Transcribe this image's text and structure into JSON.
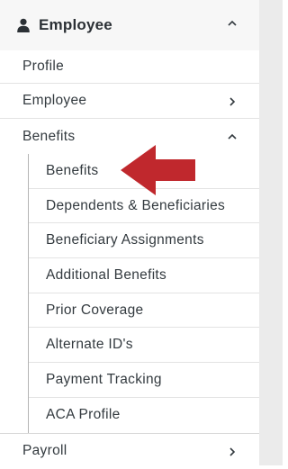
{
  "header": {
    "icon": "user-icon",
    "title": "Employee",
    "chevron": "chevron-up-icon"
  },
  "items": {
    "profile": "Profile",
    "employee": "Employee",
    "benefits": "Benefits",
    "payroll": "Payroll"
  },
  "benefits_sub": [
    "Benefits",
    "Dependents & Beneficiaries",
    "Beneficiary Assignments",
    "Additional Benefits",
    "Prior Coverage",
    "Alternate ID's",
    "Payment Tracking",
    "ACA Profile"
  ],
  "annotation": {
    "icon": "red-arrow-icon",
    "color": "#c0282d"
  }
}
